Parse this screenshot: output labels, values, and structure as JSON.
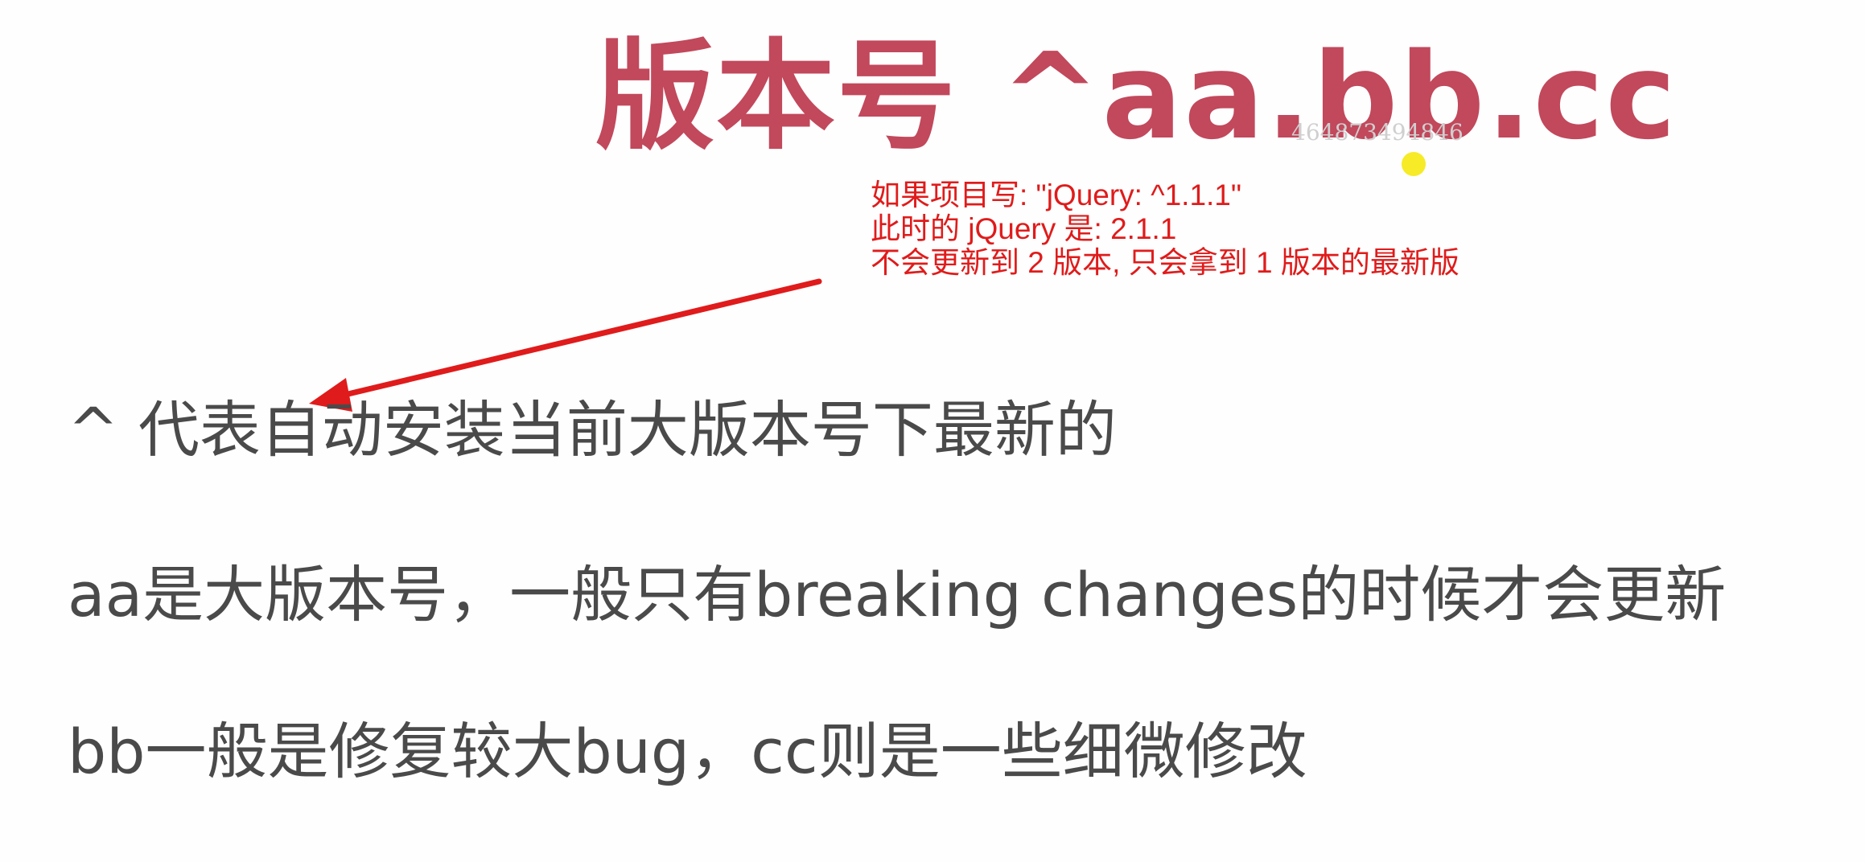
{
  "title": "版本号 ^aa.bb.cc",
  "watermark": "464873494846",
  "annotation": {
    "lines": [
      "如果项目写: \"jQuery: ^1.1.1\"",
      "此时的 jQuery 是: 2.1.1",
      "不会更新到 2 版本, 只会拿到 1 版本的最新版"
    ],
    "color": "#e01b1b"
  },
  "body": {
    "lines": [
      "^ 代表自动安装当前大版本号下最新的",
      "aa是大版本号，一般只有breaking changes的时候才会更新",
      "bb一般是修复较大bug，cc则是一些细微修改"
    ]
  },
  "colors": {
    "title": "#c2485c",
    "body_text": "#4a4a4a",
    "arrow": "#e01b1b",
    "cursor": "#f4e800"
  }
}
